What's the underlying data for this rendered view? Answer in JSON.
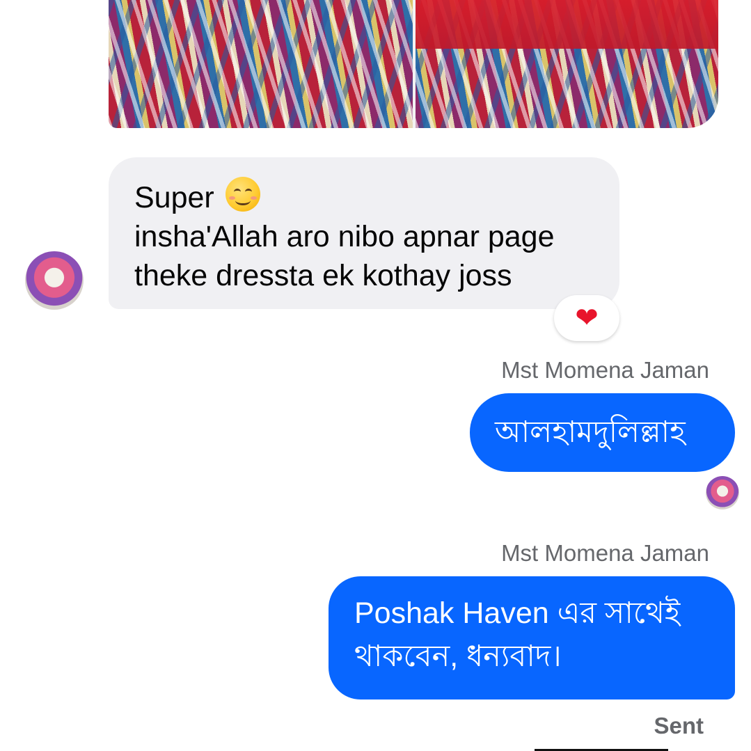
{
  "conversation": {
    "incoming": {
      "lines": [
        "Super",
        "insha'Allah aro nibo apnar page",
        "theke dressta ek kothay joss"
      ],
      "emoji": "smiling-face-emoji",
      "reaction": "❤"
    },
    "outgoing": [
      {
        "sender": "Mst Momena Jaman",
        "text": "আলহামদুলিল্লাহ"
      },
      {
        "sender": "Mst Momena Jaman",
        "lines": [
          "Poshak Haven এর সাথেই",
          "থাকবেন,  ধন্যবাদ।"
        ]
      }
    ],
    "status": "Sent"
  },
  "colors": {
    "outgoing_bubble": "#0866ff",
    "incoming_bubble": "#f0f0f3",
    "sender_text": "#65676b",
    "reaction_heart": "#e8142b"
  }
}
